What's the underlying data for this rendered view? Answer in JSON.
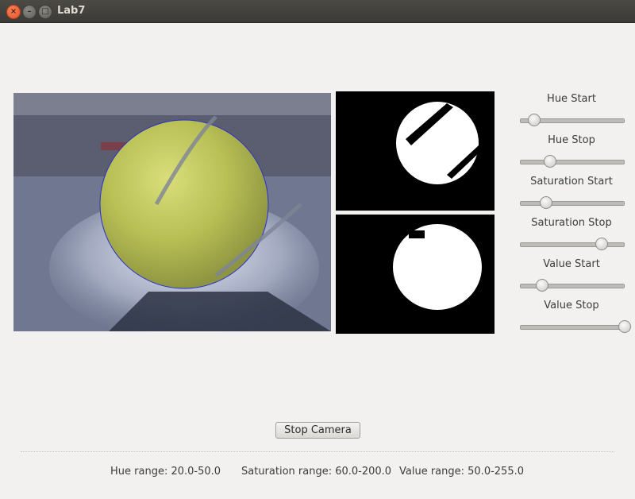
{
  "window": {
    "title": "Lab7"
  },
  "sliders": [
    {
      "label": "Hue Start",
      "level": 0.12
    },
    {
      "label": "Hue Stop",
      "level": 0.28
    },
    {
      "label": "Saturation Start",
      "level": 0.24
    },
    {
      "label": "Saturation Stop",
      "level": 0.78
    },
    {
      "label": "Value Start",
      "level": 0.2
    },
    {
      "label": "Value Stop",
      "level": 1.0
    }
  ],
  "buttons": {
    "stop_camera": "Stop Camera"
  },
  "status": {
    "hue": "Hue range: 20.0-50.0",
    "saturation": "Saturation range: 60.0-200.0",
    "value": "Value range: 50.0-255.0"
  }
}
